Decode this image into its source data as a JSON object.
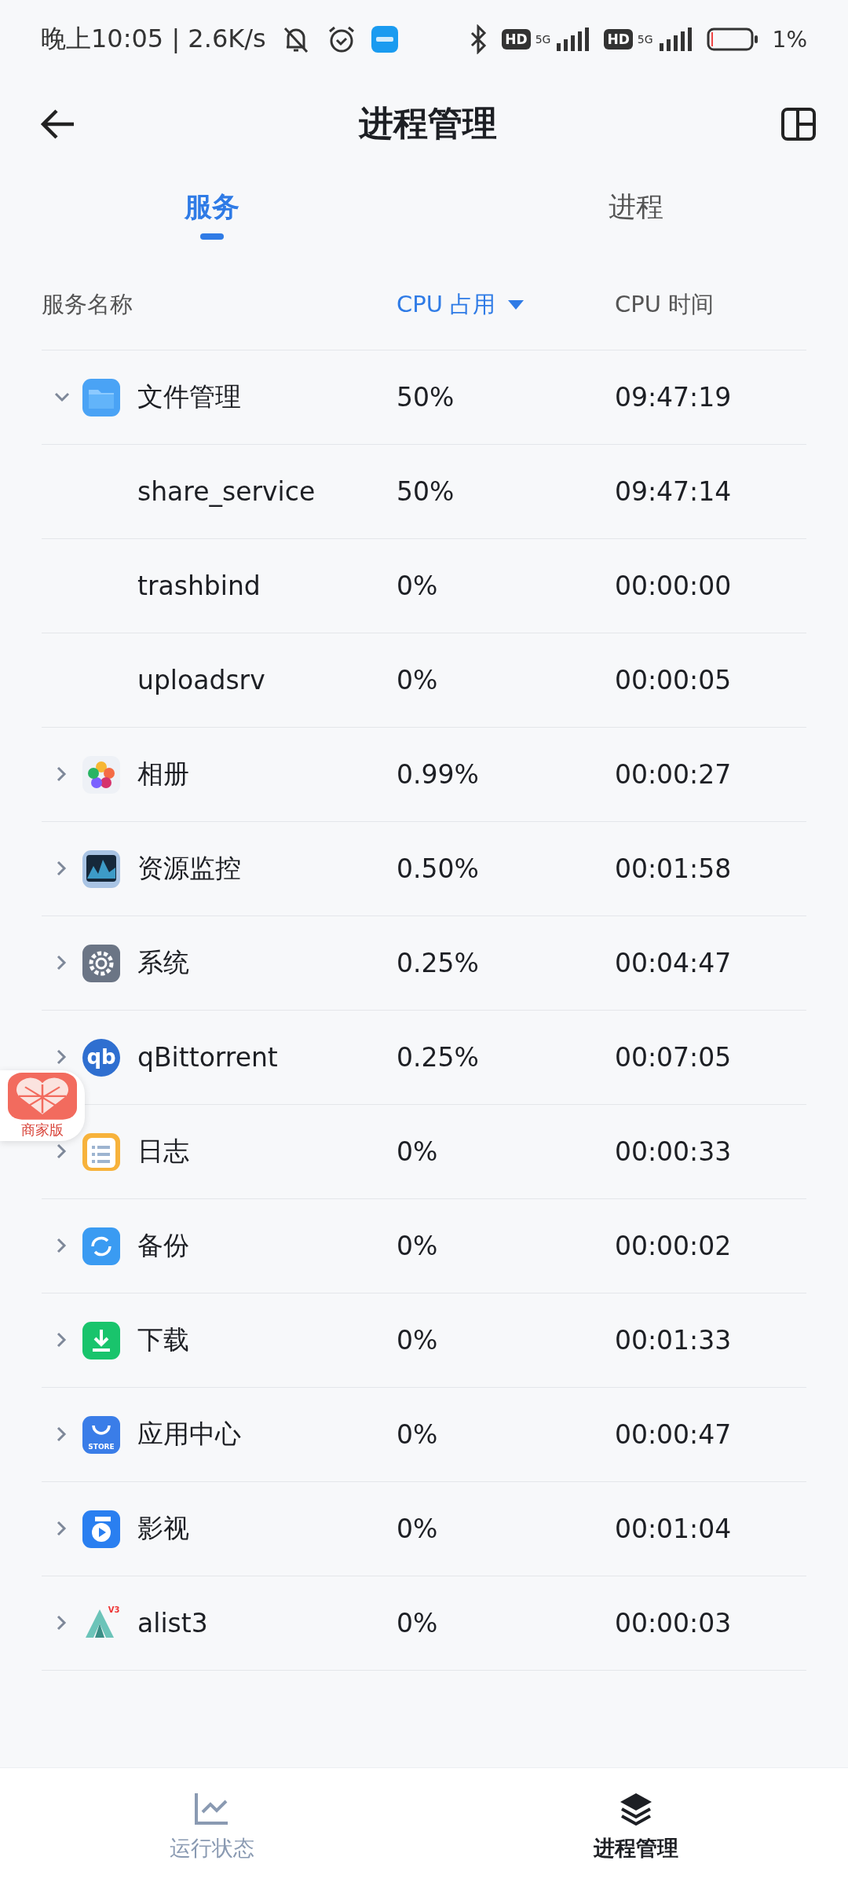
{
  "status_bar": {
    "time": "晚上10:05 | 2.6K/s",
    "networks": [
      {
        "hd": "HD",
        "type": "5G"
      },
      {
        "hd": "HD",
        "type": "5G"
      }
    ],
    "battery": "1%"
  },
  "header": {
    "title": "进程管理"
  },
  "tabs": [
    {
      "label": "服务",
      "selected": true
    },
    {
      "label": "进程",
      "selected": false
    }
  ],
  "table": {
    "columns": [
      {
        "label": "服务名称",
        "sorted": false
      },
      {
        "label": "CPU 占用",
        "sorted": true
      },
      {
        "label": "CPU 时间",
        "sorted": false
      }
    ],
    "rows": [
      {
        "name": "文件管理",
        "cpu": "50%",
        "time": "09:47:19",
        "expanded": true,
        "children": [
          {
            "name": "share_service",
            "cpu": "50%",
            "time": "09:47:14"
          },
          {
            "name": "trashbind",
            "cpu": "0%",
            "time": "00:00:00"
          },
          {
            "name": "uploadsrv",
            "cpu": "0%",
            "time": "00:00:05"
          }
        ]
      },
      {
        "name": "相册",
        "cpu": "0.99%",
        "time": "00:00:27",
        "expanded": false
      },
      {
        "name": "资源监控",
        "cpu": "0.50%",
        "time": "00:01:58",
        "expanded": false
      },
      {
        "name": "系统",
        "cpu": "0.25%",
        "time": "00:04:47",
        "expanded": false
      },
      {
        "name": "qBittorrent",
        "cpu": "0.25%",
        "time": "00:07:05",
        "expanded": false,
        "logo_text": "qb"
      },
      {
        "name": "日志",
        "cpu": "0%",
        "time": "00:00:33",
        "expanded": false
      },
      {
        "name": "备份",
        "cpu": "0%",
        "time": "00:00:02",
        "expanded": false
      },
      {
        "name": "下载",
        "cpu": "0%",
        "time": "00:01:33",
        "expanded": false
      },
      {
        "name": "应用中心",
        "cpu": "0%",
        "time": "00:00:47",
        "expanded": false,
        "logo_text": "STORE"
      },
      {
        "name": "影视",
        "cpu": "0%",
        "time": "00:01:04",
        "expanded": false
      },
      {
        "name": "alist3",
        "cpu": "0%",
        "time": "00:00:03",
        "expanded": false,
        "logo_text": "V3"
      }
    ]
  },
  "floating_badge": {
    "label": "商家版"
  },
  "bottom_nav": [
    {
      "label": "运行状态",
      "selected": false
    },
    {
      "label": "进程管理",
      "selected": true
    }
  ]
}
